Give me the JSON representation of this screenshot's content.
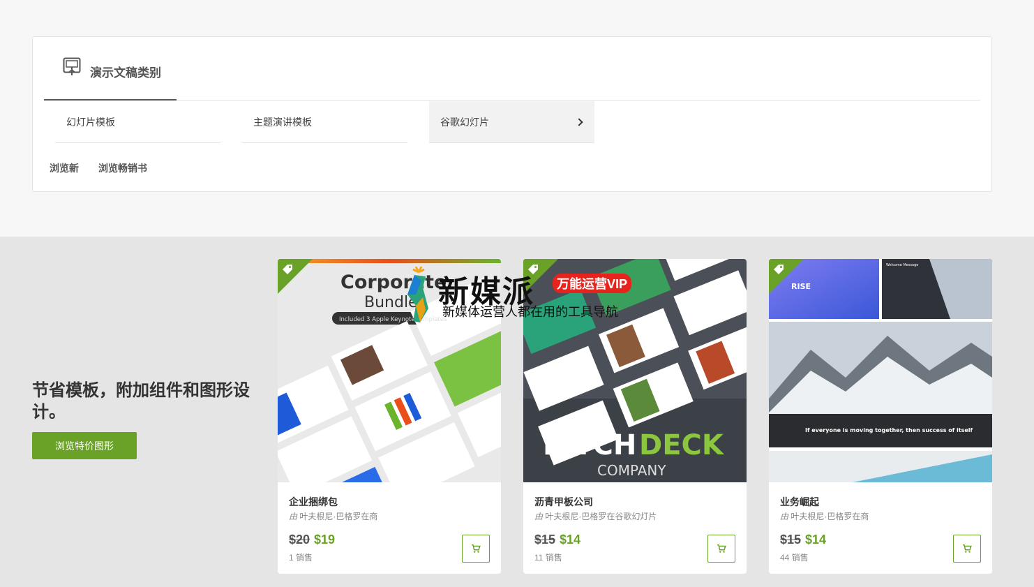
{
  "category_panel": {
    "title": "演示文稿类别",
    "items": [
      {
        "label": "幻灯片模板"
      },
      {
        "label": "主题演讲模板"
      },
      {
        "label": "谷歌幻灯片"
      }
    ],
    "browse_links": [
      "浏览新",
      "浏览畅销书"
    ]
  },
  "promo": {
    "title": "节省模板，附加组件和图形设计。",
    "button_label": "浏览特价图形"
  },
  "cards": [
    {
      "title": "企业捆绑包",
      "by": "由",
      "author": "叶夫根尼·巴格罗在商",
      "old_price": "$20",
      "new_price": "$19",
      "sales": "1 销售",
      "thumb_text": {
        "line1": "Corporate",
        "line2": "Bundle",
        "pill": "Included 3 Apple Keynote Templates"
      }
    },
    {
      "title": "沥青甲板公司",
      "by": "由",
      "author": "叶夫根尼·巴格罗在谷歌幻灯片",
      "old_price": "$15",
      "new_price": "$14",
      "sales": "11 销售",
      "thumb_text": {
        "pitch": "PITCH",
        "deck": "DECK",
        "company": "COMPANY"
      }
    },
    {
      "title": "业务崛起",
      "by": "由",
      "author": "叶夫根尼·巴格罗在商",
      "old_price": "$15",
      "new_price": "$14",
      "sales": "44 销售",
      "thumb_text": {
        "rise": "RISE",
        "welcome": "Welcome Message",
        "quote": "If everyone is moving together, then success of itself"
      }
    }
  ],
  "watermark": {
    "brand": "新媒派",
    "badge": "万能运营VIP",
    "tagline": "新媒体运营人都在用的工具导航"
  },
  "colors": {
    "accent_green": "#6aa127",
    "watermark_red": "#e6241d"
  }
}
